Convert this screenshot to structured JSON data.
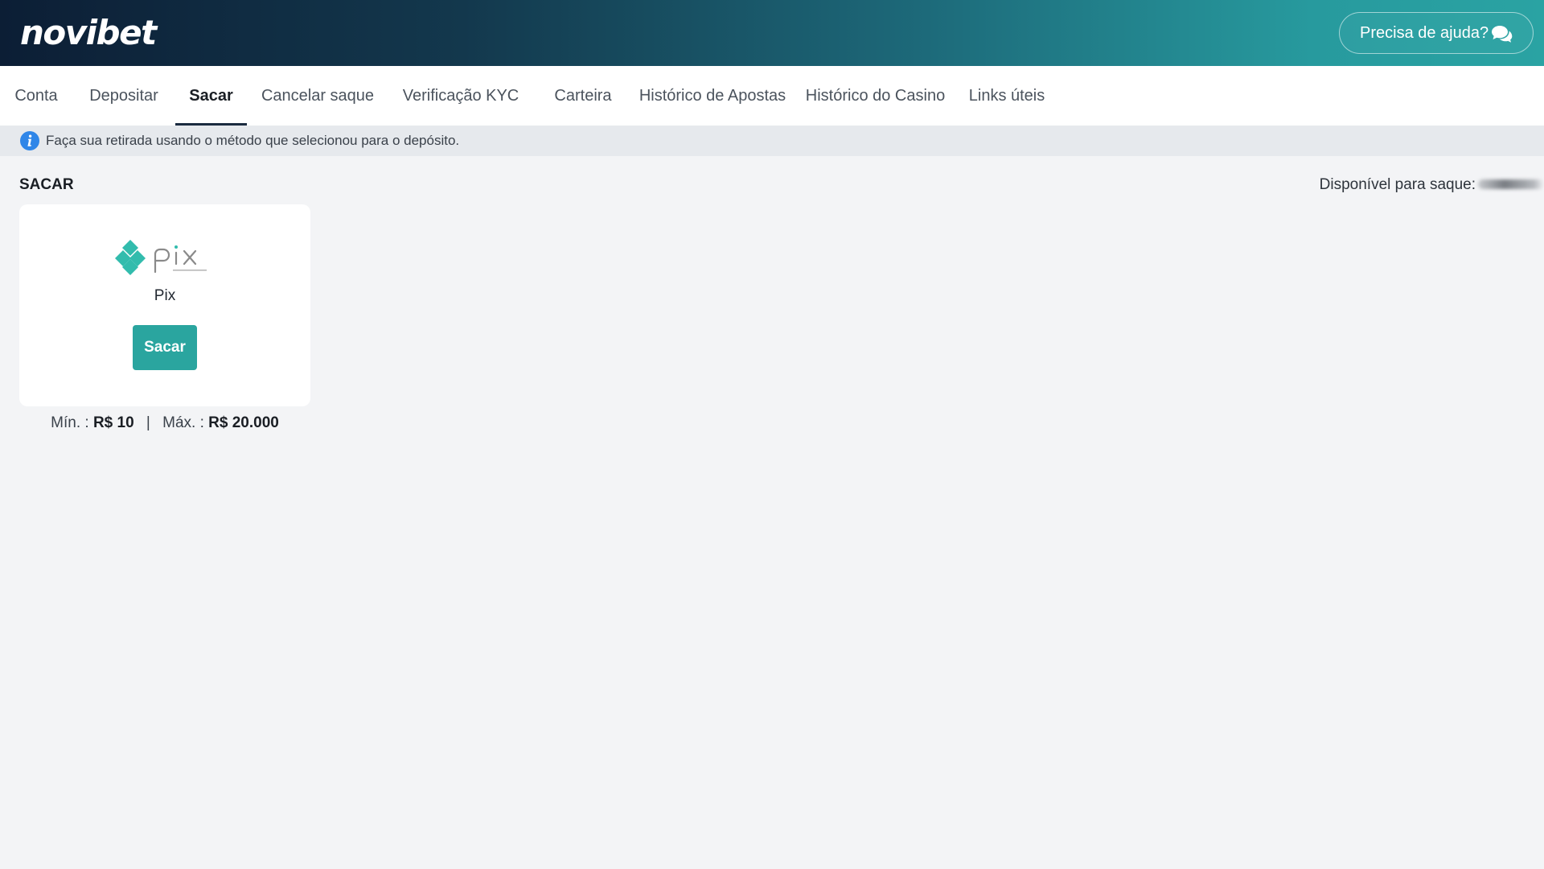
{
  "header": {
    "logo_text": "novibet",
    "help_label": "Precisa de ajuda?",
    "help_icon": "chat-bubbles-icon"
  },
  "tabs": [
    {
      "label": "Conta"
    },
    {
      "label": "Depositar"
    },
    {
      "label": "Sacar",
      "active": true
    },
    {
      "label": "Cancelar saque"
    },
    {
      "label": "Verificação KYC"
    },
    {
      "label": "Carteira"
    },
    {
      "label": "Histórico de Apostas"
    },
    {
      "label": "Histórico do Casino"
    },
    {
      "label": "Links úteis"
    }
  ],
  "info": {
    "icon": "info-icon",
    "text": "Faça sua retirada usando o método que selecionou para o depósito."
  },
  "section": {
    "title": "SACAR",
    "available_label": "Disponível para saque:"
  },
  "method": {
    "logo_text": "pix",
    "name": "Pix",
    "button_label": "Sacar",
    "min_label": "Mín. :",
    "min_value": "R$ 10",
    "separator": "|",
    "max_label": "Máx. :",
    "max_value": "R$ 20.000"
  },
  "colors": {
    "accent": "#2aa59f",
    "active_tab_underline": "#1b2b3f",
    "info_blue": "#2f86e8"
  }
}
